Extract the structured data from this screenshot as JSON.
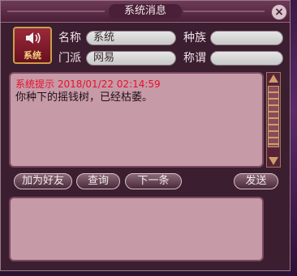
{
  "window": {
    "title": "系统消息"
  },
  "sender": {
    "avatar_label": "系统",
    "name_label": "名称",
    "name_value": "系统",
    "race_label": "种族",
    "race_value": "",
    "sect_label": "门派",
    "sect_value": "网易",
    "title_label": "称谓",
    "title_value": ""
  },
  "message": {
    "header": "系统提示 2018/01/22 02:14:59",
    "body": "你种下的摇钱树，已经枯萎。"
  },
  "buttons": {
    "add_friend": "加为好友",
    "query": "查询",
    "next": "下一条",
    "send": "发送"
  },
  "icons": {
    "avatar": "speaker-icon",
    "close": "close-icon"
  },
  "colors": {
    "header_text": "#e8102a",
    "avatar_label": "#f6d47a"
  }
}
